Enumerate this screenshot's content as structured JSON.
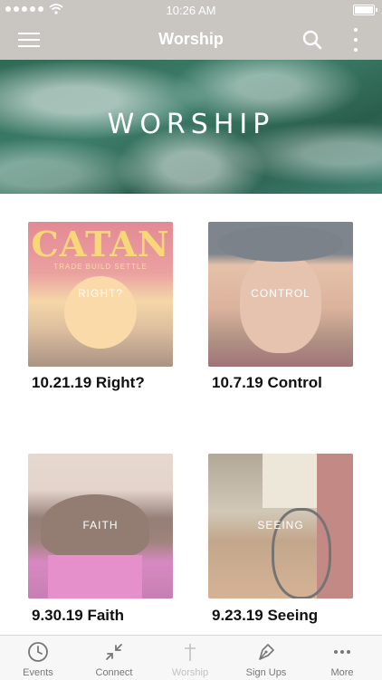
{
  "status": {
    "time": "10:26 AM"
  },
  "nav": {
    "title": "Worship"
  },
  "banner": {
    "title": "WORSHIP"
  },
  "sermons": [
    {
      "label": "RIGHT?",
      "title": "10.21.19 Right?",
      "art_text": "CATAN",
      "art_subtext": "TRADE BUILD SETTLE"
    },
    {
      "label": "CONTROL",
      "title": "10.7.19 Control"
    },
    {
      "label": "FAITH",
      "title": "9.30.19 Faith"
    },
    {
      "label": "SEEING",
      "title": "9.23.19 Seeing"
    }
  ],
  "tabs": [
    {
      "label": "Events",
      "icon": "clock-icon"
    },
    {
      "label": "Connect",
      "icon": "arrows-icon"
    },
    {
      "label": "Worship",
      "icon": "cross-icon"
    },
    {
      "label": "Sign Ups",
      "icon": "pen-icon"
    },
    {
      "label": "More",
      "icon": "more-icon"
    }
  ]
}
